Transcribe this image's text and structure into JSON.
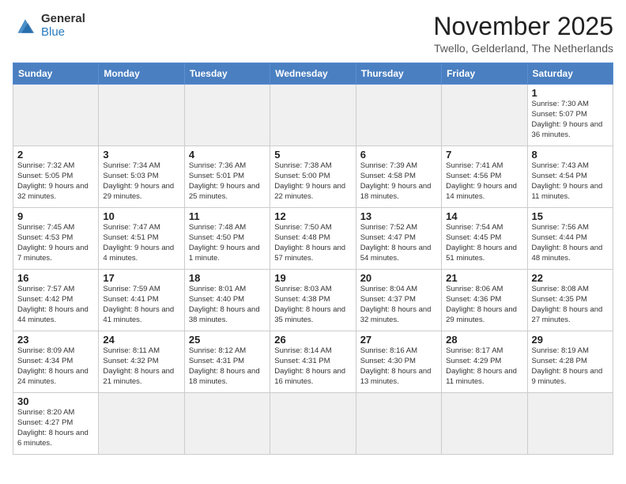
{
  "logo": {
    "line1": "General",
    "line2": "Blue"
  },
  "title": "November 2025",
  "subtitle": "Twello, Gelderland, The Netherlands",
  "weekdays": [
    "Sunday",
    "Monday",
    "Tuesday",
    "Wednesday",
    "Thursday",
    "Friday",
    "Saturday"
  ],
  "weeks": [
    [
      {
        "day": "",
        "info": ""
      },
      {
        "day": "",
        "info": ""
      },
      {
        "day": "",
        "info": ""
      },
      {
        "day": "",
        "info": ""
      },
      {
        "day": "",
        "info": ""
      },
      {
        "day": "",
        "info": ""
      },
      {
        "day": "1",
        "info": "Sunrise: 7:30 AM\nSunset: 5:07 PM\nDaylight: 9 hours and 36 minutes."
      }
    ],
    [
      {
        "day": "2",
        "info": "Sunrise: 7:32 AM\nSunset: 5:05 PM\nDaylight: 9 hours and 32 minutes."
      },
      {
        "day": "3",
        "info": "Sunrise: 7:34 AM\nSunset: 5:03 PM\nDaylight: 9 hours and 29 minutes."
      },
      {
        "day": "4",
        "info": "Sunrise: 7:36 AM\nSunset: 5:01 PM\nDaylight: 9 hours and 25 minutes."
      },
      {
        "day": "5",
        "info": "Sunrise: 7:38 AM\nSunset: 5:00 PM\nDaylight: 9 hours and 22 minutes."
      },
      {
        "day": "6",
        "info": "Sunrise: 7:39 AM\nSunset: 4:58 PM\nDaylight: 9 hours and 18 minutes."
      },
      {
        "day": "7",
        "info": "Sunrise: 7:41 AM\nSunset: 4:56 PM\nDaylight: 9 hours and 14 minutes."
      },
      {
        "day": "8",
        "info": "Sunrise: 7:43 AM\nSunset: 4:54 PM\nDaylight: 9 hours and 11 minutes."
      }
    ],
    [
      {
        "day": "9",
        "info": "Sunrise: 7:45 AM\nSunset: 4:53 PM\nDaylight: 9 hours and 7 minutes."
      },
      {
        "day": "10",
        "info": "Sunrise: 7:47 AM\nSunset: 4:51 PM\nDaylight: 9 hours and 4 minutes."
      },
      {
        "day": "11",
        "info": "Sunrise: 7:48 AM\nSunset: 4:50 PM\nDaylight: 9 hours and 1 minute."
      },
      {
        "day": "12",
        "info": "Sunrise: 7:50 AM\nSunset: 4:48 PM\nDaylight: 8 hours and 57 minutes."
      },
      {
        "day": "13",
        "info": "Sunrise: 7:52 AM\nSunset: 4:47 PM\nDaylight: 8 hours and 54 minutes."
      },
      {
        "day": "14",
        "info": "Sunrise: 7:54 AM\nSunset: 4:45 PM\nDaylight: 8 hours and 51 minutes."
      },
      {
        "day": "15",
        "info": "Sunrise: 7:56 AM\nSunset: 4:44 PM\nDaylight: 8 hours and 48 minutes."
      }
    ],
    [
      {
        "day": "16",
        "info": "Sunrise: 7:57 AM\nSunset: 4:42 PM\nDaylight: 8 hours and 44 minutes."
      },
      {
        "day": "17",
        "info": "Sunrise: 7:59 AM\nSunset: 4:41 PM\nDaylight: 8 hours and 41 minutes."
      },
      {
        "day": "18",
        "info": "Sunrise: 8:01 AM\nSunset: 4:40 PM\nDaylight: 8 hours and 38 minutes."
      },
      {
        "day": "19",
        "info": "Sunrise: 8:03 AM\nSunset: 4:38 PM\nDaylight: 8 hours and 35 minutes."
      },
      {
        "day": "20",
        "info": "Sunrise: 8:04 AM\nSunset: 4:37 PM\nDaylight: 8 hours and 32 minutes."
      },
      {
        "day": "21",
        "info": "Sunrise: 8:06 AM\nSunset: 4:36 PM\nDaylight: 8 hours and 29 minutes."
      },
      {
        "day": "22",
        "info": "Sunrise: 8:08 AM\nSunset: 4:35 PM\nDaylight: 8 hours and 27 minutes."
      }
    ],
    [
      {
        "day": "23",
        "info": "Sunrise: 8:09 AM\nSunset: 4:34 PM\nDaylight: 8 hours and 24 minutes."
      },
      {
        "day": "24",
        "info": "Sunrise: 8:11 AM\nSunset: 4:32 PM\nDaylight: 8 hours and 21 minutes."
      },
      {
        "day": "25",
        "info": "Sunrise: 8:12 AM\nSunset: 4:31 PM\nDaylight: 8 hours and 18 minutes."
      },
      {
        "day": "26",
        "info": "Sunrise: 8:14 AM\nSunset: 4:31 PM\nDaylight: 8 hours and 16 minutes."
      },
      {
        "day": "27",
        "info": "Sunrise: 8:16 AM\nSunset: 4:30 PM\nDaylight: 8 hours and 13 minutes."
      },
      {
        "day": "28",
        "info": "Sunrise: 8:17 AM\nSunset: 4:29 PM\nDaylight: 8 hours and 11 minutes."
      },
      {
        "day": "29",
        "info": "Sunrise: 8:19 AM\nSunset: 4:28 PM\nDaylight: 8 hours and 9 minutes."
      }
    ],
    [
      {
        "day": "30",
        "info": "Sunrise: 8:20 AM\nSunset: 4:27 PM\nDaylight: 8 hours and 6 minutes."
      },
      {
        "day": "",
        "info": ""
      },
      {
        "day": "",
        "info": ""
      },
      {
        "day": "",
        "info": ""
      },
      {
        "day": "",
        "info": ""
      },
      {
        "day": "",
        "info": ""
      },
      {
        "day": "",
        "info": ""
      }
    ]
  ]
}
